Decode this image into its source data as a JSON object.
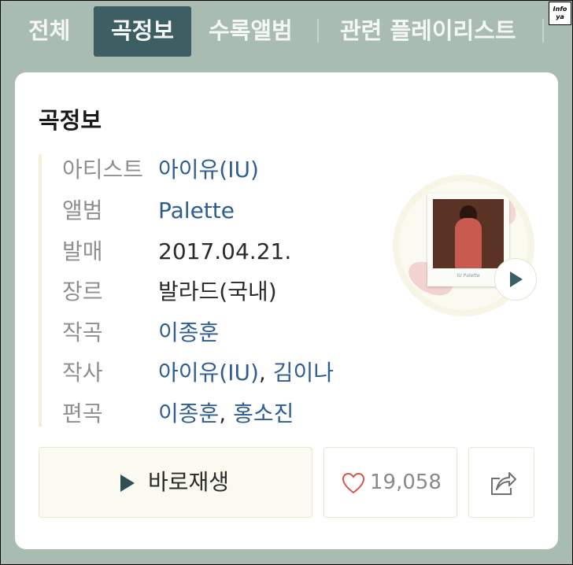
{
  "tabs": [
    {
      "label": "전체",
      "active": false
    },
    {
      "label": "곡정보",
      "active": true
    },
    {
      "label": "수록앨범",
      "active": false
    },
    {
      "label": "관련 플레이리스트",
      "active": false
    }
  ],
  "watermark": {
    "line1": "Info",
    "line2": "ya"
  },
  "card": {
    "title": "곡정보",
    "rows": [
      {
        "label": "아티스트",
        "values": [
          "아이유(IU)"
        ]
      },
      {
        "label": "앨범",
        "values": [
          "Palette"
        ]
      },
      {
        "label": "발매",
        "values": [
          "2017.04.21."
        ]
      },
      {
        "label": "장르",
        "values": [
          "발라드(국내)"
        ]
      },
      {
        "label": "작곡",
        "values": [
          "이종훈"
        ]
      },
      {
        "label": "작사",
        "values": [
          "아이유(IU)",
          "김이나"
        ]
      },
      {
        "label": "편곡",
        "values": [
          "이종훈",
          "홍소진"
        ]
      }
    ],
    "separator": ", ",
    "cover_caption": "IU Palette"
  },
  "actions": {
    "play_label": "바로재생",
    "like_count": "19,058"
  },
  "colors": {
    "background": "#a9bcb1",
    "active_tab": "#3d5e63",
    "link": "#2e5d92",
    "heart": "#d9534f"
  },
  "icons": [
    "play-icon",
    "heart-icon",
    "share-icon"
  ]
}
